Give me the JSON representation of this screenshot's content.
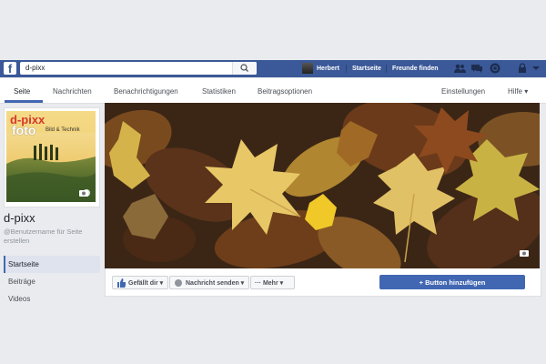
{
  "topbar": {
    "logo": "f",
    "search_value": "d-pixx",
    "user_name": "Herbert",
    "home_label": "Startseite",
    "friends_label": "Freunde finden",
    "icons": [
      "friend-requests-icon",
      "messages-icon",
      "notifications-icon",
      "lock-icon",
      "dropdown-icon"
    ]
  },
  "nav": {
    "items": [
      "Seite",
      "Nachrichten",
      "Benachrichtigungen",
      "Statistiken",
      "Beitragsoptionen"
    ],
    "settings": "Einstellungen",
    "help": "Hilfe ▾"
  },
  "page": {
    "name": "d-pixx",
    "username_prompt": "@Benutzername für Seite erstellen",
    "logo_line1": "d-pixx",
    "logo_line2": "foto",
    "logo_tagline": "Bild & Technik"
  },
  "sidebar": {
    "items": [
      "Startseite",
      "Beiträge",
      "Videos"
    ],
    "active": "Startseite"
  },
  "actions": {
    "like": "Gefällt dir ▾",
    "message": "Nachricht senden ▾",
    "more": "··· Mehr ▾",
    "add_button": "+ Button hinzufügen"
  },
  "colors": {
    "facebook_blue": "#3b5998",
    "button_blue": "#4267b2",
    "background": "#e9ebee"
  }
}
